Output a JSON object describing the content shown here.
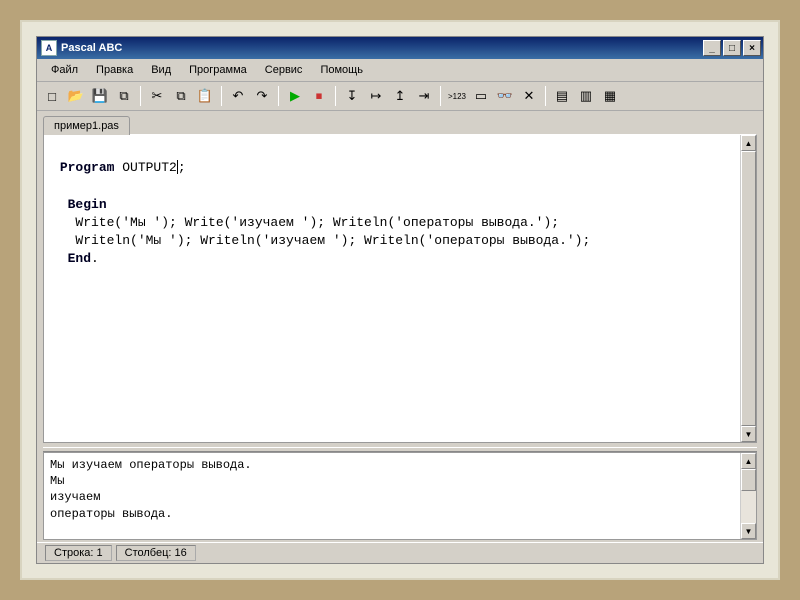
{
  "window": {
    "title": "Pascal ABC",
    "app_icon_text": "A",
    "min_glyph": "_",
    "max_glyph": "□",
    "close_glyph": "×"
  },
  "menu": {
    "items": [
      "Файл",
      "Правка",
      "Вид",
      "Программа",
      "Сервис",
      "Помощь"
    ]
  },
  "toolbar": {
    "groups": [
      [
        "new-file-icon",
        "open-file-icon",
        "save-file-icon",
        "save-all-icon"
      ],
      [
        "cut-icon",
        "copy-icon",
        "paste-icon"
      ],
      [
        "undo-icon",
        "redo-icon"
      ],
      [
        "run-icon",
        "stop-icon"
      ],
      [
        "step-into-icon",
        "step-over-icon",
        "step-out-icon",
        "run-to-cursor-icon"
      ],
      [
        "goto-line-icon",
        "window-list-icon",
        "watch-icon",
        "close-doc-icon"
      ],
      [
        "tile-horiz-icon",
        "tile-vert-icon",
        "cascade-icon"
      ]
    ],
    "glyphs": {
      "new-file-icon": "□",
      "open-file-icon": "📂",
      "save-file-icon": "💾",
      "save-all-icon": "⧉",
      "cut-icon": "✂",
      "copy-icon": "⧉",
      "paste-icon": "📋",
      "undo-icon": "↶",
      "redo-icon": "↷",
      "run-icon": "▶",
      "stop-icon": "⏹",
      "step-into-icon": "↧",
      "step-over-icon": "↦",
      "step-out-icon": "↥",
      "run-to-cursor-icon": "⇥",
      "goto-line-icon": ">123",
      "window-list-icon": "▭",
      "watch-icon": "👓",
      "close-doc-icon": "✕",
      "tile-horiz-icon": "▤",
      "tile-vert-icon": "▥",
      "cascade-icon": "▦"
    },
    "run_color": "#0a0",
    "stop_color": "#c33"
  },
  "tabs": {
    "active": "пример1.pas"
  },
  "code": {
    "line1_kw": "Program",
    "line1_id": " OUTPUT2",
    "line1_end": ";",
    "begin_kw": "Begin",
    "l3a": "   Write('Мы '); Write('изучаем '); Writeln('операторы вывода.');",
    "l4a": "   Writeln('Мы '); Writeln('изучаем '); Writeln('операторы вывода.');",
    "end_kw": "End",
    "end_dot": "."
  },
  "output": {
    "lines": [
      "Мы изучаем операторы вывода.",
      "Мы",
      "изучаем",
      "операторы вывода."
    ]
  },
  "status": {
    "line_label": "Строка:",
    "line_val": "1",
    "col_label": "Столбец:",
    "col_val": "16"
  }
}
